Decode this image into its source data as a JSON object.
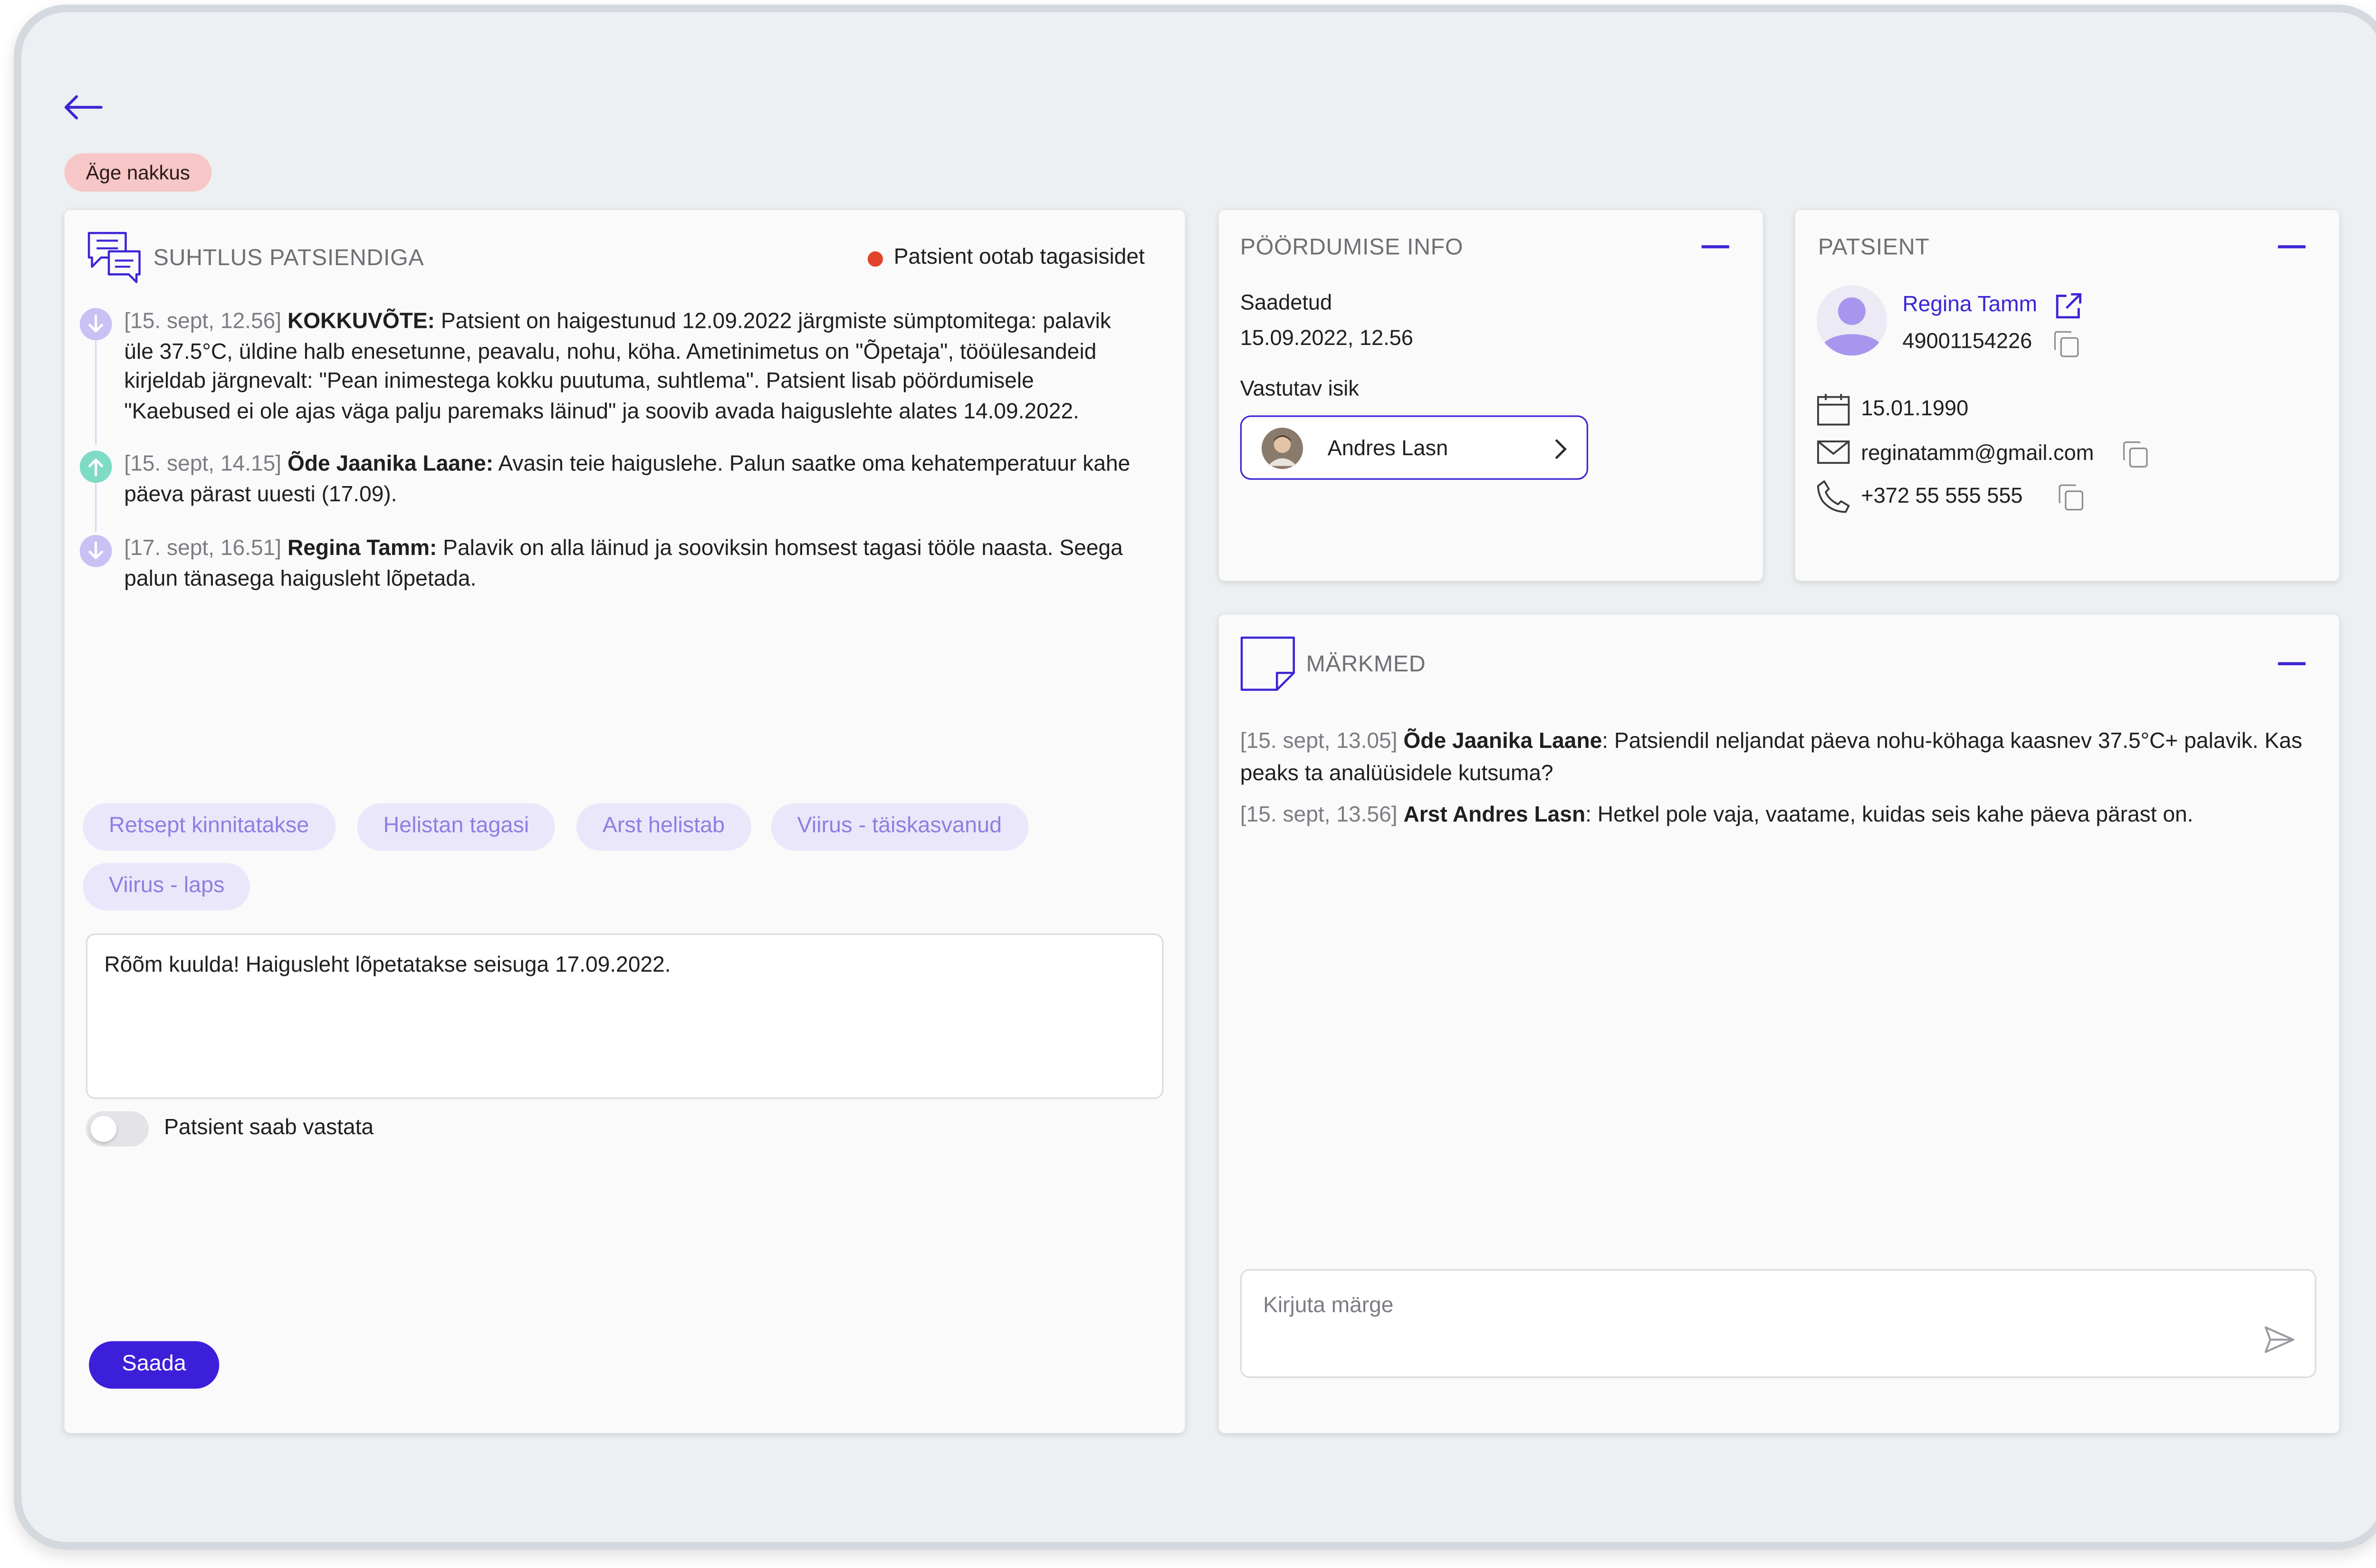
{
  "badge": "Äge nakkus",
  "communication": {
    "title": "SUHTLUS PATSIENDIGA",
    "status": "Patsient ootab tagasisidet",
    "status_color": "#e0452b",
    "messages": [
      {
        "time": "[15. sept, 12.56]",
        "author": "KOKKUVÕTE:",
        "direction": "incoming",
        "lines": [
          "Patsient on haigestunud 12.09.2022 järgmiste sümptomitega: palavik",
          "üle 37.5°C, üldine halb enesetunne, peavalu, nohu, köha. Ametinimetus on \"Õpetaja\", tööülesandeid",
          "kirjeldab järgnevalt: \"Pean inimestega kokku puutuma, suhtlema\". Patsient lisab pöördumisele",
          "\"Kaebused ei ole ajas väga palju paremaks läinud\" ja soovib avada haiguslehte alates 14.09.2022."
        ]
      },
      {
        "time": "[15. sept, 14.15]",
        "author": "Õde Jaanika Laane:",
        "direction": "outgoing",
        "lines": [
          "Avasin teie haiguslehe. Palun saatke oma kehatemperatuur kahe",
          "päeva pärast uuesti (17.09)."
        ]
      },
      {
        "time": "[17. sept, 16.51]",
        "author": "Regina Tamm:",
        "direction": "incoming",
        "lines": [
          "Palavik on alla läinud ja sooviksin homsest tagasi tööle naasta. Seega",
          "palun tänasega haigusleht lõpetada."
        ]
      }
    ],
    "quick_replies": [
      "Retsept kinnitatakse",
      "Helistan tagasi",
      "Arst helistab",
      "Viirus - täiskasvanud",
      "Viirus - laps"
    ],
    "reply_text": "Rõõm kuulda! Haigusleht lõpetatakse seisuga 17.09.2022.",
    "toggle_label": "Patsient saab vastata",
    "toggle_on": false,
    "send_label": "Saada"
  },
  "request_info": {
    "title": "PÖÖRDUMISE INFO",
    "sent_label": "Saadetud",
    "sent_value": "15.09.2022, 12.56",
    "responsible_label": "Vastutav isik",
    "responsible_name": "Andres Lasn"
  },
  "patient": {
    "title": "PATSIENT",
    "name": "Regina Tamm",
    "id_code": "49001154226",
    "birth_date": "15.01.1990",
    "email": "reginatamm@gmail.com",
    "phone": "+372 55 555 555"
  },
  "notes": {
    "title": "MÄRKMED",
    "items": [
      {
        "time": "[15. sept, 13.05]",
        "author": "Õde Jaanika Laane",
        "lines": [
          "Patsiendil neljandat päeva nohu-köhaga kaasnev 37.5°C+ palavik. Kas",
          "peaks ta analüüsidele kutsuma?"
        ]
      },
      {
        "time": "[15. sept, 13.56]",
        "author": "Arst Andres Lasn",
        "lines": [
          "Hetkel pole vaja, vaatame, kuidas seis kahe päeva pärast on."
        ]
      }
    ],
    "input_placeholder": "Kirjuta märge"
  },
  "colors": {
    "accent": "#3b25d6",
    "incoming_icon": "#c9c0f4",
    "outgoing_icon": "#7fdcc4",
    "badge_bg": "#f7c6c6"
  }
}
